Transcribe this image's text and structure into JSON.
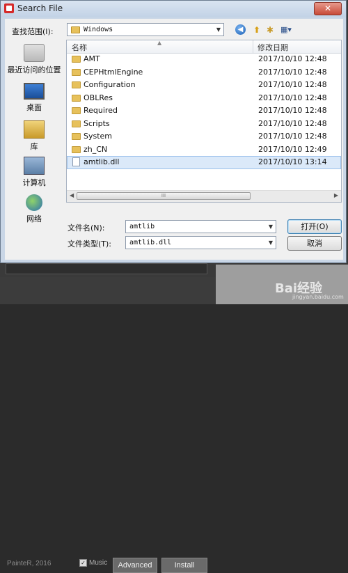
{
  "dialog": {
    "title": "Search File",
    "close_label": "✕",
    "look_in_label": "查找范围(I):",
    "look_in_value": "Windows",
    "toolbar": {
      "back": "◀",
      "up": "⬆",
      "new_folder": "✱",
      "view": "▦▾"
    }
  },
  "places": [
    {
      "label": "最近访问的位置",
      "icon": "recent-places-icon"
    },
    {
      "label": "桌面",
      "icon": "desktop-icon"
    },
    {
      "label": "库",
      "icon": "libraries-icon"
    },
    {
      "label": "计算机",
      "icon": "computer-icon"
    },
    {
      "label": "网络",
      "icon": "network-icon"
    }
  ],
  "list": {
    "col_name": "名称",
    "col_date": "修改日期",
    "rows": [
      {
        "name": "AMT",
        "date": "2017/10/10 12:48",
        "type": "folder"
      },
      {
        "name": "CEPHtmlEngine",
        "date": "2017/10/10 12:48",
        "type": "folder"
      },
      {
        "name": "Configuration",
        "date": "2017/10/10 12:48",
        "type": "folder"
      },
      {
        "name": "OBLRes",
        "date": "2017/10/10 12:48",
        "type": "folder"
      },
      {
        "name": "Required",
        "date": "2017/10/10 12:48",
        "type": "folder"
      },
      {
        "name": "Scripts",
        "date": "2017/10/10 12:48",
        "type": "folder"
      },
      {
        "name": "System",
        "date": "2017/10/10 12:48",
        "type": "folder"
      },
      {
        "name": "zh_CN",
        "date": "2017/10/10 12:49",
        "type": "folder"
      },
      {
        "name": "amtlib.dll",
        "date": "2017/10/10 13:14",
        "type": "file"
      }
    ],
    "scroll_grip": "III"
  },
  "bottom": {
    "filename_label": "文件名(N):",
    "filename_value": "amtlib",
    "filetype_label": "文件类型(T):",
    "filetype_value": "amtlib.dll",
    "open_button": "打开(O)",
    "cancel_button": "取消"
  },
  "background_app": {
    "brand": "PainteR, 2016",
    "music_label": "Music",
    "advanced_button": "Advanced",
    "install_button": "Install"
  },
  "watermark": {
    "text": "Bai经验",
    "sub": "jingyan.baidu.com"
  }
}
